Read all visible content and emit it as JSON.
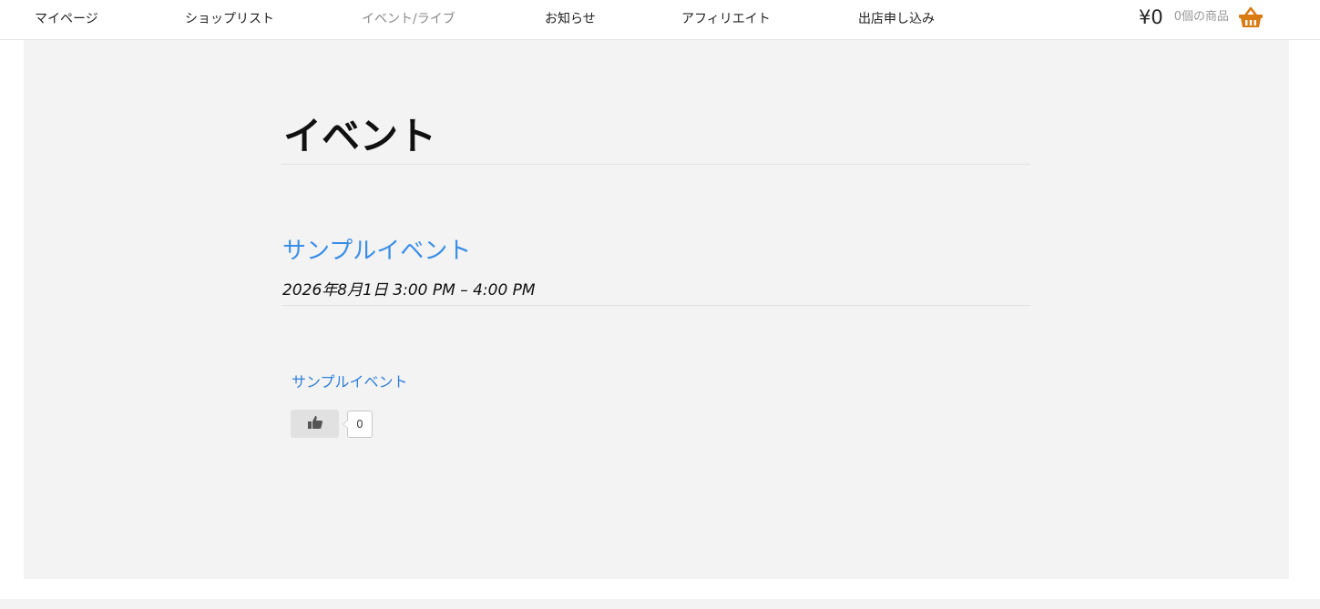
{
  "nav": {
    "items": [
      {
        "label": "マイページ"
      },
      {
        "label": "ショップリスト"
      },
      {
        "label": "イベント/ライブ"
      },
      {
        "label": "お知らせ"
      },
      {
        "label": "アフィリエイト"
      },
      {
        "label": "出店申し込み"
      }
    ]
  },
  "cart": {
    "total": "¥0",
    "count_label": "0個の商品",
    "icon": "basket-icon",
    "icon_color": "#d97a12"
  },
  "page": {
    "title": "イベント"
  },
  "event": {
    "title": "サンプルイベント",
    "date": "2026年8月1日 3:00 PM – 4:00 PM",
    "link_label": "サンプルイベント",
    "like_icon": "thumbs-up-icon",
    "like_count": "0"
  },
  "colors": {
    "link": "#3a8ee6",
    "content_bg": "#f3f3f3",
    "current_nav": "#8a8a8a"
  }
}
